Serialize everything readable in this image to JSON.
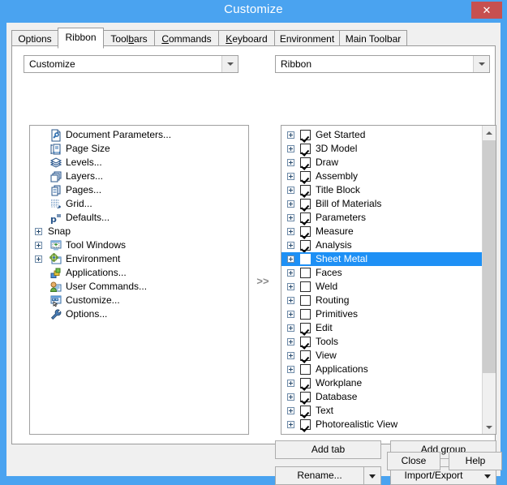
{
  "window": {
    "title": "Customize",
    "close_label": "✕",
    "accent_color": "#4aa3f0",
    "close_color": "#c75050"
  },
  "tabs": [
    {
      "label": "Options",
      "accel": "",
      "active": false
    },
    {
      "label": "Ribbon",
      "accel": "",
      "active": true
    },
    {
      "label": "Toolbars",
      "accel": "b",
      "active": false
    },
    {
      "label": "Commands",
      "accel": "C",
      "active": false
    },
    {
      "label": "Keyboard",
      "accel": "K",
      "active": false
    },
    {
      "label": "Environment",
      "accel": "",
      "active": false
    },
    {
      "label": "Main Toolbar",
      "accel": "",
      "active": false
    }
  ],
  "left_combo": {
    "value": "Customize",
    "icon": "chevron-down-icon"
  },
  "right_combo": {
    "value": "Ribbon",
    "icon": "chevron-down-icon"
  },
  "left_list": {
    "items": [
      {
        "label": "Document Parameters...",
        "icon": "document-parameters-icon",
        "indent": 1,
        "expander": false
      },
      {
        "label": "Page Size",
        "icon": "page-size-icon",
        "indent": 1,
        "expander": false
      },
      {
        "label": "Levels...",
        "icon": "levels-icon",
        "indent": 1,
        "expander": false
      },
      {
        "label": "Layers...",
        "icon": "layers-icon",
        "indent": 1,
        "expander": false
      },
      {
        "label": "Pages...",
        "icon": "pages-icon",
        "indent": 1,
        "expander": false
      },
      {
        "label": "Grid...",
        "icon": "grid-icon",
        "indent": 1,
        "expander": false
      },
      {
        "label": "Defaults...",
        "icon": "defaults-icon",
        "indent": 1,
        "expander": false
      },
      {
        "label": "Snap",
        "icon": "none",
        "indent": 0,
        "expander": true
      },
      {
        "label": "Tool Windows",
        "icon": "tool-windows-icon",
        "indent": 1,
        "expander": true
      },
      {
        "label": "Environment",
        "icon": "environment-icon",
        "indent": 1,
        "expander": true
      },
      {
        "label": "Applications...",
        "icon": "applications-icon",
        "indent": 1,
        "expander": false
      },
      {
        "label": "User Commands...",
        "icon": "user-commands-icon",
        "indent": 1,
        "expander": false
      },
      {
        "label": "Customize...",
        "icon": "customize-icon",
        "indent": 1,
        "expander": false
      },
      {
        "label": "Options...",
        "icon": "options-wrench-icon",
        "indent": 1,
        "expander": false
      }
    ]
  },
  "transfer_button": {
    "label": ">>"
  },
  "right_list": {
    "items": [
      {
        "label": "Get Started",
        "checked": true,
        "selected": false
      },
      {
        "label": "3D Model",
        "checked": true,
        "selected": false
      },
      {
        "label": "Draw",
        "checked": true,
        "selected": false
      },
      {
        "label": "Assembly",
        "checked": true,
        "selected": false
      },
      {
        "label": "Title Block",
        "checked": true,
        "selected": false
      },
      {
        "label": "Bill of Materials",
        "checked": true,
        "selected": false
      },
      {
        "label": "Parameters",
        "checked": true,
        "selected": false
      },
      {
        "label": "Measure",
        "checked": true,
        "selected": false
      },
      {
        "label": "Analysis",
        "checked": true,
        "selected": false
      },
      {
        "label": "Sheet Metal",
        "checked": false,
        "selected": true
      },
      {
        "label": "Faces",
        "checked": false,
        "selected": false
      },
      {
        "label": "Weld",
        "checked": false,
        "selected": false
      },
      {
        "label": "Routing",
        "checked": false,
        "selected": false
      },
      {
        "label": "Primitives",
        "checked": false,
        "selected": false
      },
      {
        "label": "Edit",
        "checked": true,
        "selected": false
      },
      {
        "label": "Tools",
        "checked": true,
        "selected": false
      },
      {
        "label": "View",
        "checked": true,
        "selected": false
      },
      {
        "label": "Applications",
        "checked": false,
        "selected": false
      },
      {
        "label": "Workplane",
        "checked": true,
        "selected": false
      },
      {
        "label": "Database",
        "checked": true,
        "selected": false
      },
      {
        "label": "Text",
        "checked": true,
        "selected": false
      },
      {
        "label": "Photorealistic View",
        "checked": true,
        "selected": false
      }
    ],
    "scrollbar": {
      "up_icon": "chevron-up-icon",
      "down_icon": "chevron-down-icon",
      "thumb_top_pct": 4.6,
      "thumb_height_pct": 83
    }
  },
  "action_buttons": {
    "add_tab": "Add tab",
    "add_group": "Add group",
    "rename": "Rename...",
    "import_export": "Import/Export",
    "rename_dropdown_icon": "caret-down-icon",
    "import_export_dropdown_icon": "caret-down-icon"
  },
  "footer_buttons": {
    "close": "Close",
    "help": "Help"
  }
}
